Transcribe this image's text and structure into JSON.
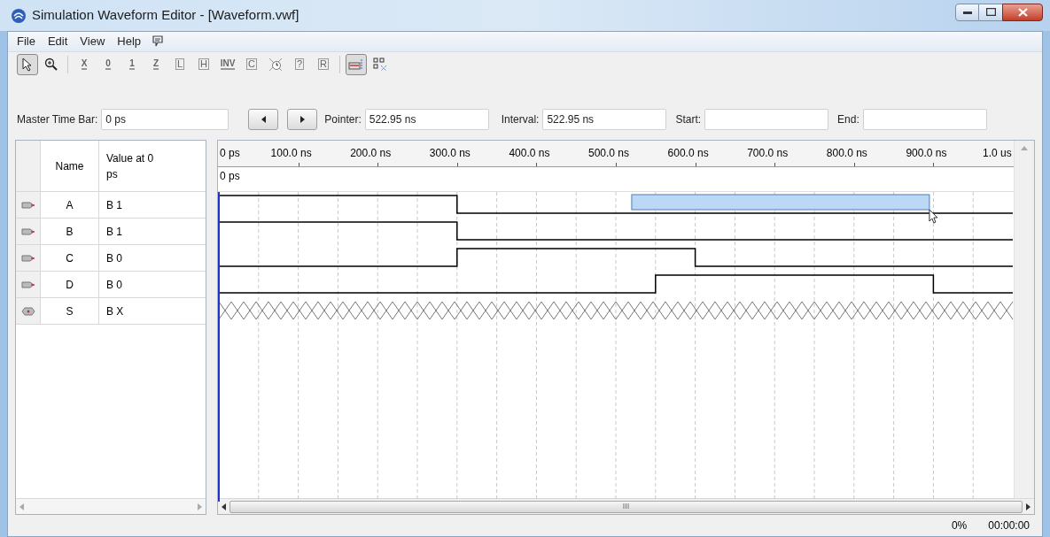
{
  "window": {
    "title": "Simulation Waveform Editor - [Waveform.vwf]"
  },
  "menu": [
    {
      "label": "File"
    },
    {
      "label": "Edit"
    },
    {
      "label": "View"
    },
    {
      "label": "Help"
    }
  ],
  "toolbar": [
    {
      "kind": "pointer",
      "selected": true
    },
    {
      "kind": "zoom",
      "selected": false
    },
    {
      "kind": "glyph",
      "label": "X",
      "selected": false
    },
    {
      "kind": "glyph",
      "label": "0",
      "selected": false
    },
    {
      "kind": "glyph",
      "label": "1",
      "selected": false
    },
    {
      "kind": "glyph",
      "label": "Z",
      "selected": false
    },
    {
      "kind": "xglyph",
      "label": "L",
      "selected": false
    },
    {
      "kind": "xglyph",
      "label": "H",
      "selected": false
    },
    {
      "kind": "glyph",
      "label": "INV",
      "selected": false
    },
    {
      "kind": "xglyph",
      "label": "C",
      "selected": false
    },
    {
      "kind": "clock",
      "selected": false
    },
    {
      "kind": "xglyph",
      "label": "?",
      "selected": false
    },
    {
      "kind": "xglyph",
      "label": "R",
      "selected": false
    },
    {
      "kind": "snap",
      "selected": true
    },
    {
      "kind": "grid",
      "selected": false
    }
  ],
  "time_bar": {
    "master_label": "Master Time Bar:",
    "master_value": "0 ps",
    "pointer_label": "Pointer:",
    "pointer_value": "522.95 ns",
    "interval_label": "Interval:",
    "interval_value": "522.95 ns",
    "start_label": "Start:",
    "end_label": "End:"
  },
  "table": {
    "columns": [
      "Name",
      "Value at 0 ps"
    ]
  },
  "ruler": {
    "ticks": [
      "0 ps",
      "100.0 ns",
      "200.0 ns",
      "300.0 ns",
      "400.0 ns",
      "500.0 ns",
      "600.0 ns",
      "700.0 ns",
      "800.0 ns",
      "900.0 ns",
      "1.0 us"
    ],
    "master_marker": "0 ps"
  },
  "signals": [
    {
      "kind": "input",
      "name": "A",
      "value": "B 1"
    },
    {
      "kind": "input",
      "name": "B",
      "value": "B 1"
    },
    {
      "kind": "input",
      "name": "C",
      "value": "B 0"
    },
    {
      "kind": "input",
      "name": "D",
      "value": "B 0"
    },
    {
      "kind": "output",
      "name": "S",
      "value": "B X"
    }
  ],
  "horizontal_scroll": {
    "center_mark": "III"
  },
  "status_bar": [
    "0%",
    "00:00:00"
  ]
}
